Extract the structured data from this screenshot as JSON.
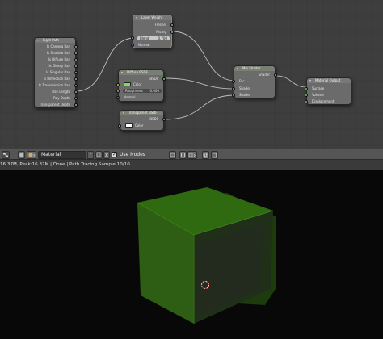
{
  "nodes": {
    "light_path": {
      "title": "Light Path",
      "outputs": [
        "Is Camera Ray",
        "Is Shadow Ray",
        "Is Diffuse Ray",
        "Is Glossy Ray",
        "Is Singular Ray",
        "Is Reflection Ray",
        "Is Transmission Ray",
        "Ray Length",
        "Ray Depth",
        "Transparent Depth"
      ]
    },
    "layer_weight": {
      "title": "Layer Weight",
      "outputs": [
        "Fresnel",
        "Facing"
      ],
      "blend_label": "Blend",
      "blend_value": "0.700",
      "normal_label": "Normal"
    },
    "diffuse_bsdf": {
      "title": "Diffuse BSDF",
      "output": "BSDF",
      "color_label": "Color",
      "color": "#7fdc55",
      "roughness_label": "Roughness",
      "roughness_value": "0.000",
      "normal_label": "Normal"
    },
    "transparent_bsdf": {
      "title": "Transparent BSDF",
      "output": "BSDF",
      "color_label": "Color",
      "color": "#ffffff"
    },
    "mix_shader": {
      "title": "Mix Shader",
      "output": "Shader",
      "inputs": [
        "Fac",
        "Shader",
        "Shader"
      ]
    },
    "material_output": {
      "title": "Material Output",
      "inputs": [
        "Surface",
        "Volume",
        "Displacement"
      ]
    }
  },
  "header": {
    "material_name": "Material",
    "fake_user": "F",
    "use_nodes_label": "Use Nodes",
    "use_nodes_checked": "✓"
  },
  "status_text": "16.37M, Peak:16.37M | Done | Path Tracing Sample 10/10",
  "colors": {
    "node_editor_bg": "#3e3e3e",
    "viewport_bg": "#080808",
    "cube_green": "#2f6a10",
    "shader_socket": "#6ccd43",
    "float_socket": "#a1a1a1",
    "color_socket": "#c7c729",
    "vector_socket": "#6a6ac4"
  }
}
